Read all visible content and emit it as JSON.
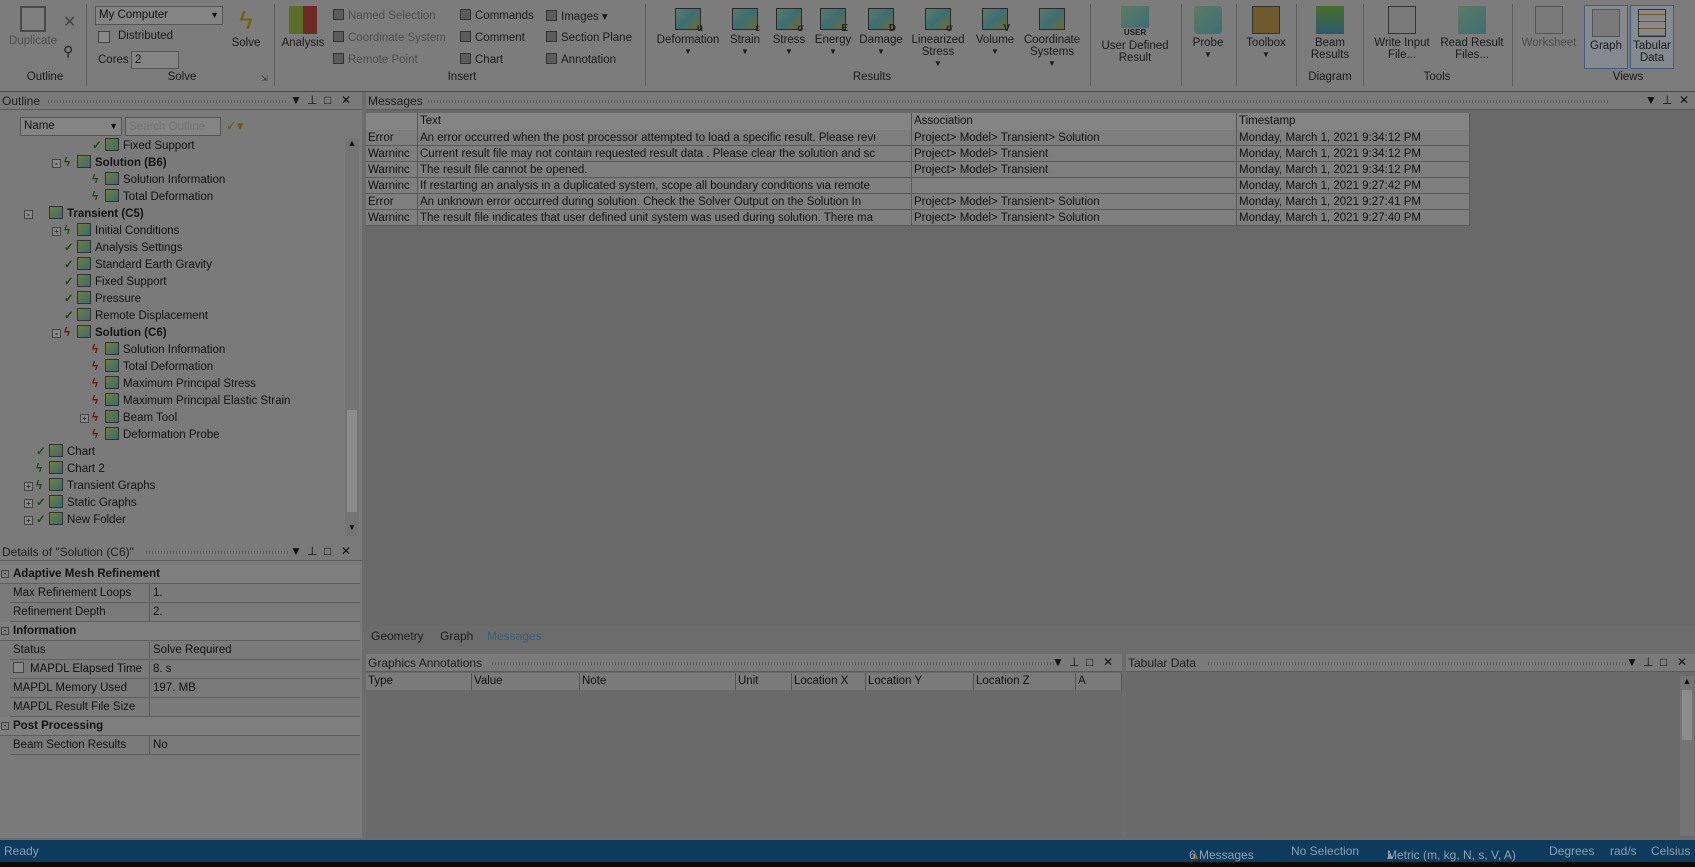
{
  "ribbon": {
    "outline_group": {
      "duplicate": "Duplicate",
      "label": "Outline"
    },
    "solve_group": {
      "machine": "My Computer",
      "distributed": "Distributed",
      "cores_label": "Cores",
      "cores_value": "2",
      "solve": "Solve",
      "label": "Solve"
    },
    "insert_group": {
      "analysis": "Analysis",
      "named_selection": "Named Selection",
      "coordinate_system": "Coordinate System",
      "remote_point": "Remote Point",
      "commands": "Commands",
      "comment": "Comment",
      "chart": "Chart",
      "images": "Images",
      "section_plane": "Section Plane",
      "annotation": "Annotation",
      "label": "Insert"
    },
    "results_group": {
      "items": [
        {
          "label": "Deformation",
          "glyph": "u"
        },
        {
          "label": "Strain",
          "glyph": "ε"
        },
        {
          "label": "Stress",
          "glyph": "σ"
        },
        {
          "label": "Energy",
          "glyph": "E"
        },
        {
          "label": "Damage",
          "glyph": "D"
        },
        {
          "label": "Linearized Stress",
          "glyph": "σ"
        },
        {
          "label": "Volume",
          "glyph": "V"
        },
        {
          "label": "Coordinate Systems",
          "glyph": ""
        }
      ],
      "label": "Results"
    },
    "user_defined": {
      "badge": "USER",
      "line1": "User Defined",
      "line2": "Result"
    },
    "probe": "Probe",
    "toolbox": "Toolbox",
    "beam_results": {
      "line1": "Beam",
      "line2": "Results"
    },
    "diagram_label": "Diagram",
    "write_input": {
      "line1": "Write Input",
      "line2": "File..."
    },
    "read_result": {
      "line1": "Read Result",
      "line2": "Files..."
    },
    "tools_label": "Tools",
    "worksheet": "Worksheet",
    "graph": "Graph",
    "tabular": {
      "line1": "Tabular",
      "line2": "Data"
    },
    "views_label": "Views"
  },
  "outline": {
    "title": "Outline",
    "filter_select": "Name",
    "search_placeholder": "Search Outline",
    "tree": [
      {
        "label": "Fixed Support",
        "depth": 3,
        "status": "check",
        "bold": false
      },
      {
        "label": "Solution (B6)",
        "depth": 2,
        "status": "bolt",
        "bold": true,
        "expander": "-"
      },
      {
        "label": "Solution Information",
        "depth": 3,
        "status": "bolt",
        "bold": false
      },
      {
        "label": "Total Deformation",
        "depth": 3,
        "status": "bolt",
        "bold": false
      },
      {
        "label": "Transient (C5)",
        "depth": 1,
        "status": "none",
        "bold": true,
        "expander": "-"
      },
      {
        "label": "Initial Conditions",
        "depth": 2,
        "status": "bolt",
        "bold": false,
        "expander": "+"
      },
      {
        "label": "Analysis Settings",
        "depth": 2,
        "status": "check",
        "bold": false
      },
      {
        "label": "Standard Earth Gravity",
        "depth": 2,
        "status": "check",
        "bold": false
      },
      {
        "label": "Fixed Support",
        "depth": 2,
        "status": "check",
        "bold": false
      },
      {
        "label": "Pressure",
        "depth": 2,
        "status": "check",
        "bold": false
      },
      {
        "label": "Remote Displacement",
        "depth": 2,
        "status": "check",
        "bold": false
      },
      {
        "label": "Solution (C6)",
        "depth": 2,
        "status": "error",
        "bold": true,
        "expander": "-"
      },
      {
        "label": "Solution Information",
        "depth": 3,
        "status": "error",
        "bold": false
      },
      {
        "label": "Total Deformation",
        "depth": 3,
        "status": "error",
        "bold": false
      },
      {
        "label": "Maximum Principal Stress",
        "depth": 3,
        "status": "error",
        "bold": false
      },
      {
        "label": "Maximum Principal Elastic Strain",
        "depth": 3,
        "status": "error",
        "bold": false
      },
      {
        "label": "Beam Tool",
        "depth": 3,
        "status": "error",
        "bold": false,
        "expander": "+"
      },
      {
        "label": "Deformation Probe",
        "depth": 3,
        "status": "error",
        "bold": false
      },
      {
        "label": "Chart",
        "depth": 1,
        "status": "check",
        "bold": false
      },
      {
        "label": "Chart 2",
        "depth": 1,
        "status": "bolt",
        "bold": false
      },
      {
        "label": "Transient Graphs",
        "depth": 1,
        "status": "bolt",
        "bold": false,
        "expander": "+"
      },
      {
        "label": "Static Graphs",
        "depth": 1,
        "status": "check",
        "bold": false,
        "expander": "+"
      },
      {
        "label": "New Folder",
        "depth": 1,
        "status": "check",
        "bold": false,
        "expander": "+"
      }
    ]
  },
  "details": {
    "title": "Details of \"Solution (C6)\"",
    "sections": [
      {
        "name": "Adaptive Mesh Refinement",
        "rows": [
          {
            "key": "Max Refinement Loops",
            "value": "1."
          },
          {
            "key": "Refinement Depth",
            "value": "2."
          }
        ]
      },
      {
        "name": "Information",
        "rows": [
          {
            "key": "Status",
            "value": "Solve Required"
          },
          {
            "key": "MAPDL Elapsed Time",
            "value": "8. s",
            "checkbox": true
          },
          {
            "key": "MAPDL Memory Used",
            "value": "197. MB"
          },
          {
            "key": "MAPDL Result File Size",
            "value": ""
          }
        ]
      },
      {
        "name": "Post Processing",
        "rows": [
          {
            "key": "Beam Section Results",
            "value": "No"
          }
        ]
      }
    ]
  },
  "messages": {
    "title": "Messages",
    "columns": [
      "Text",
      "Association",
      "Timestamp"
    ],
    "rows": [
      {
        "type": "Error",
        "text": "An error occurred when the post processor attempted to load a specific result. Please revi",
        "assoc": "Project> Model> Transient> Solution",
        "time": "Monday, March 1, 2021 9:34:12 PM"
      },
      {
        "type": "Warninc",
        "text": "Current result file may not contain requested result data . Please clear the solution and sc",
        "assoc": "Project> Model> Transient",
        "time": "Monday, March 1, 2021 9:34:12 PM"
      },
      {
        "type": "Warninc",
        "text": "The result file  cannot be opened.",
        "assoc": "Project> Model> Transient",
        "time": "Monday, March 1, 2021 9:34:12 PM"
      },
      {
        "type": "Warninc",
        "text": "If restarting an analysis in a duplicated system, scope all boundary conditions via remote",
        "assoc": "",
        "time": "Monday, March 1, 2021 9:27:42 PM"
      },
      {
        "type": "Error",
        "text": "An unknown error occurred during solution.  Check the Solver Output on the Solution In",
        "assoc": "Project> Model> Transient> Solution",
        "time": "Monday, March 1, 2021 9:27:41 PM"
      },
      {
        "type": "Warninc",
        "text": "The result file indicates that user defined unit system was used during solution.  There ma",
        "assoc": "Project> Model> Transient> Solution",
        "time": "Monday, March 1, 2021 9:27:40 PM"
      }
    ]
  },
  "bottom_tabs": [
    "Geometry",
    "Graph",
    "Messages"
  ],
  "graphics_annotations": {
    "title": "Graphics Annotations",
    "columns": [
      "Type",
      "Value",
      "Note",
      "Unit",
      "Location X",
      "Location Y",
      "Location Z",
      "A"
    ]
  },
  "tabular_data": {
    "title": "Tabular Data"
  },
  "status_bar": {
    "ready": "Ready",
    "messages": "6 Messages",
    "selection": "No Selection",
    "units": "Metric (m, kg, N, s, V, A)",
    "angle": "Degrees",
    "rate": "rad/s",
    "temperature": "Celsius"
  },
  "colors": {
    "status_bar": "#0d3b5e",
    "accent": "#3e5e7e",
    "check": "#1c4a14",
    "error": "#6a1410"
  }
}
